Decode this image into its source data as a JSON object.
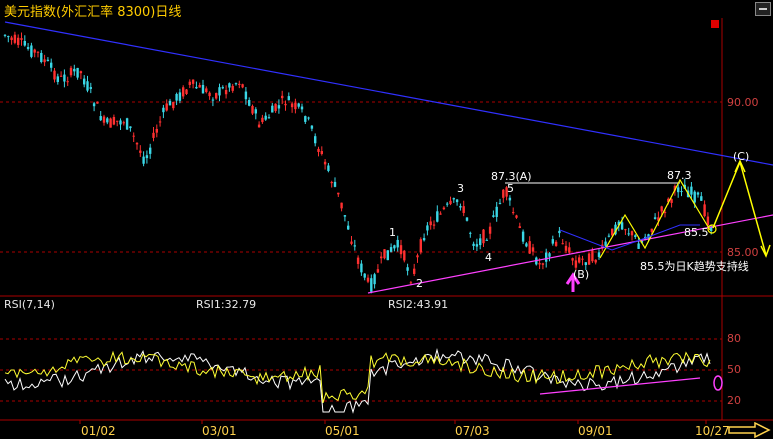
{
  "title": "美元指数(外汇汇率 8300)日线",
  "price_axis": [
    "90.00",
    "85.00"
  ],
  "rsi": {
    "label": "RSI(7,14)",
    "rsi1": "RSI1:32.79",
    "rsi2": "RSI2:43.91",
    "levels": [
      "80",
      "50",
      "20"
    ]
  },
  "dates": [
    "01/02",
    "03/01",
    "05/01",
    "07/03",
    "09/01",
    "10/27"
  ],
  "wave_labels": {
    "w1": "1",
    "w2": "2",
    "w3": "3",
    "w4": "4",
    "w5": "5",
    "A": "87.3(A)",
    "B": "(B)",
    "C": "(C)",
    "peak": "87.3",
    "support": "85.5"
  },
  "support_note": "85.5为日K趋势支持线",
  "colors": {
    "background": "#000000",
    "up_candle": "#ff3030",
    "down_candle": "#3ad7e6",
    "trendline_down": "#3030ff",
    "trendline_support": "#ff40ff",
    "projection": "#ffff00",
    "rsi1": "#ffffff",
    "rsi2": "#ffff33",
    "grid": "#aa0000"
  }
}
